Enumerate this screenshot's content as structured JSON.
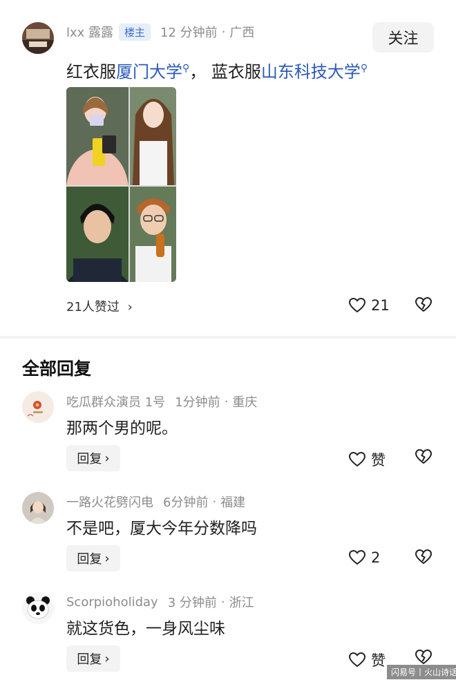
{
  "post": {
    "author": "lxx 露露",
    "badge": "楼主",
    "time": "12 分钟前",
    "location": "广西",
    "follow_label": "关注",
    "text_prefix": "红衣服",
    "link1": "厦门大学",
    "text_middle": "，  蓝衣服",
    "link2": "山东科技大学",
    "likes_summary": "21人赞过",
    "like_count": "21"
  },
  "replies": {
    "section_title": "全部回复",
    "items": [
      {
        "author": "吃瓜群众演员 1号",
        "time": "1分钟前",
        "location": "重庆",
        "text": "那两个男的呢。",
        "reply_label": "回复",
        "like_label": "赞"
      },
      {
        "author": "一路火花劈闪电",
        "time": "6分钟前",
        "location": "福建",
        "text": "不是吧，厦大今年分数降吗",
        "reply_label": "回复",
        "like_label": "2"
      },
      {
        "author": "Scorpioholiday",
        "time": "3 分钟前",
        "location": "浙江",
        "text": "就这货色，一身风尘味",
        "reply_label": "回复",
        "like_label": "赞"
      }
    ]
  },
  "icons": {
    "heart": "heart-icon",
    "broken_heart": "broken-heart-icon",
    "chevron": "chevron-right-icon",
    "search": "search-icon"
  },
  "colors": {
    "link": "#2b59b8",
    "meta": "#8c8c8c",
    "badge_bg": "#e8eef8",
    "badge_text": "#3a6dd8",
    "button_bg": "#f3f3f3"
  },
  "watermark": "闪易号丨火山诗话"
}
